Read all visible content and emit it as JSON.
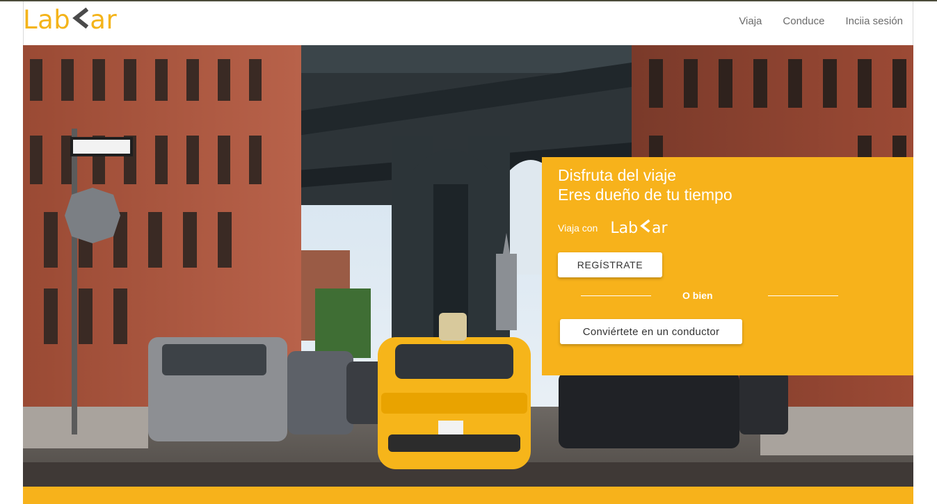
{
  "header": {
    "logo_left": "Lab",
    "logo_right": "ar",
    "nav": [
      {
        "label": "Viaja"
      },
      {
        "label": "Conduce"
      },
      {
        "label": "Inciia sesión"
      }
    ]
  },
  "hero": {
    "image": "city street with taxi under bridge"
  },
  "card": {
    "title_line1": "Disfruta del viaje",
    "title_line2": "Eres dueño de tu tiempo",
    "viaja_label": "Viaja con",
    "mini_logo_left": "Lab",
    "mini_logo_right": "ar",
    "register_label": "REGÍSTRATE",
    "or_label": "O bien",
    "driver_label": "Conviértete en un conductor"
  },
  "colors": {
    "accent": "#f7b21b",
    "logo_yellow": "#f4b41a",
    "logo_chevron": "#4a4a4a"
  }
}
